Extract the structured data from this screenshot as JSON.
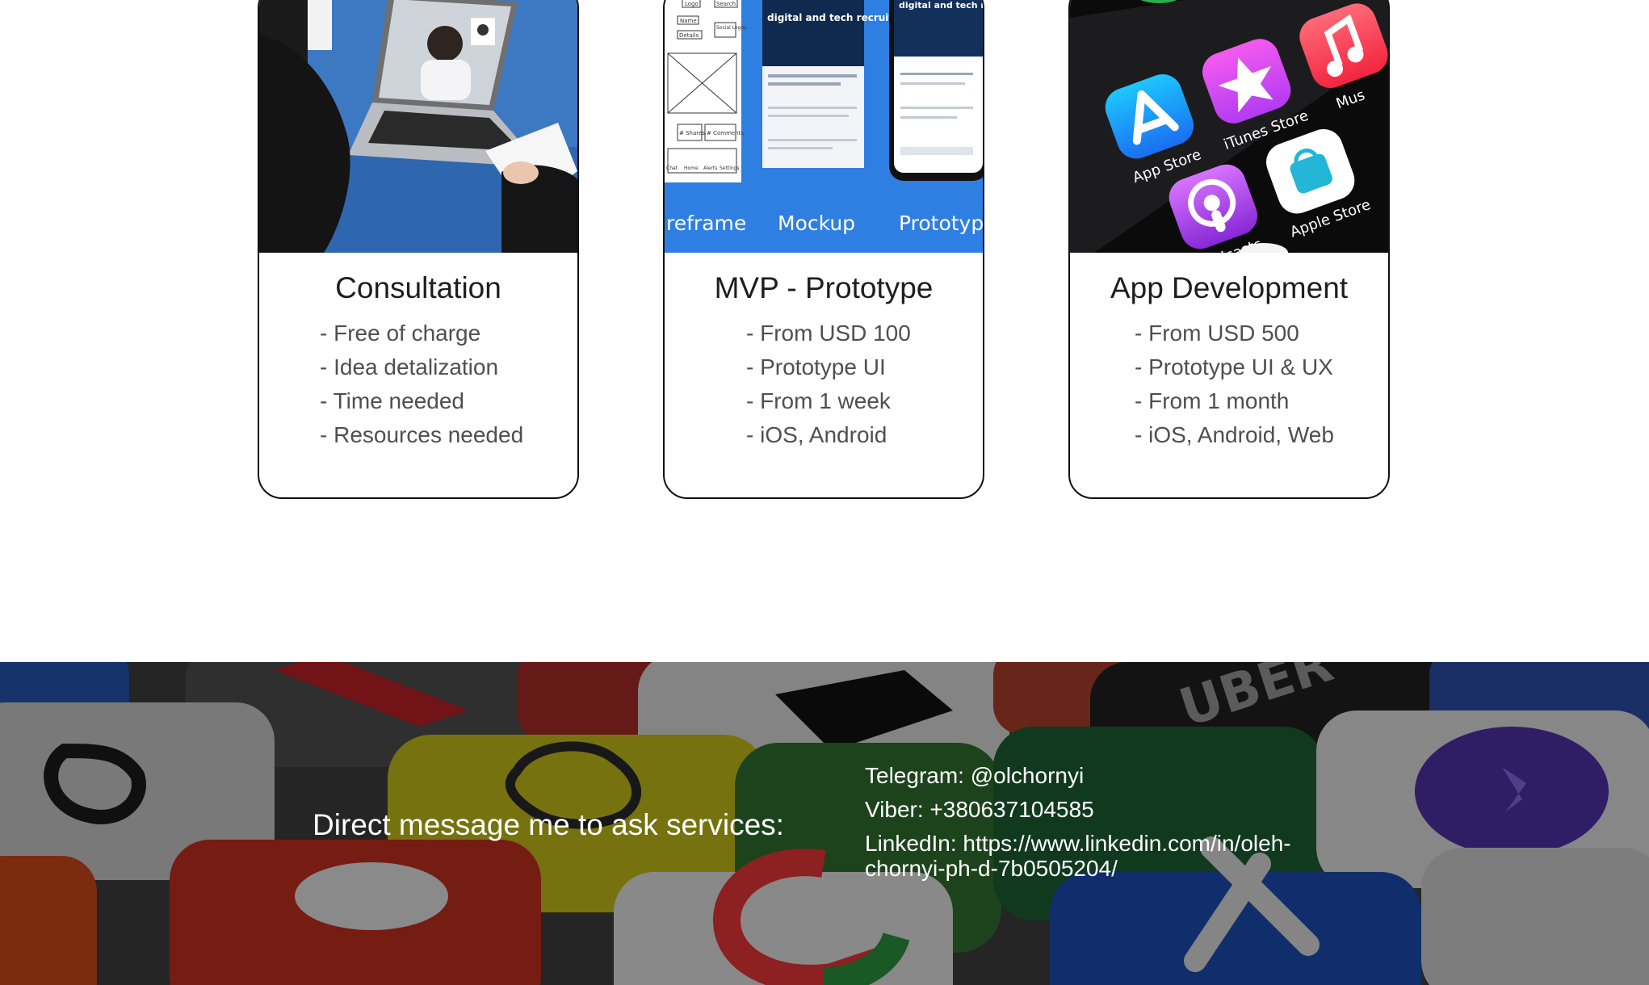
{
  "cards": [
    {
      "title": "Consultation",
      "items": [
        "- Free of charge",
        "- Idea detalization",
        "- Time needed",
        "- Resources needed"
      ]
    },
    {
      "title": "MVP - Prototype",
      "items": [
        "- From USD 100",
        "- Prototype UI",
        "- From 1 week",
        "- iOS, Android"
      ],
      "image_labels": {
        "wireframe": "reframe",
        "mockup": "Mockup",
        "prototype": "Prototype",
        "screen_heading": "digital and tech recruitment",
        "wire_logo": "Logo",
        "wire_search": "Search",
        "wire_name": "Name",
        "wire_details": "Details",
        "wire_social": "Social Logos",
        "wire_shares": "# Shares",
        "wire_comments": "# Comments",
        "wire_nav": [
          "Chat",
          "Home",
          "Alerts",
          "Settings"
        ]
      }
    },
    {
      "title": "App Development",
      "items": [
        "- From USD 500",
        "- Prototype UI & UX",
        "- From 1 month",
        "- iOS, Android, Web"
      ],
      "image_labels": {
        "app_store": "App Store",
        "itunes_store": "iTunes Store",
        "music": "Mus",
        "podcasts": "Podcasts",
        "apple_store": "Apple Store"
      }
    }
  ],
  "footer": {
    "cta": "Direct message me to ask services:",
    "telegram": "Telegram: @olchornyi",
    "viber": "Viber: +380637104585",
    "linkedin": "LinkedIn: https://www.linkedin.com/in/oleh-chornyi-ph-d-7b0505204/",
    "background_text": "UBER"
  },
  "colors": {
    "accent_blue": "#2f7fe2",
    "card_border": "#111111",
    "list_text": "#4f4f4f"
  }
}
